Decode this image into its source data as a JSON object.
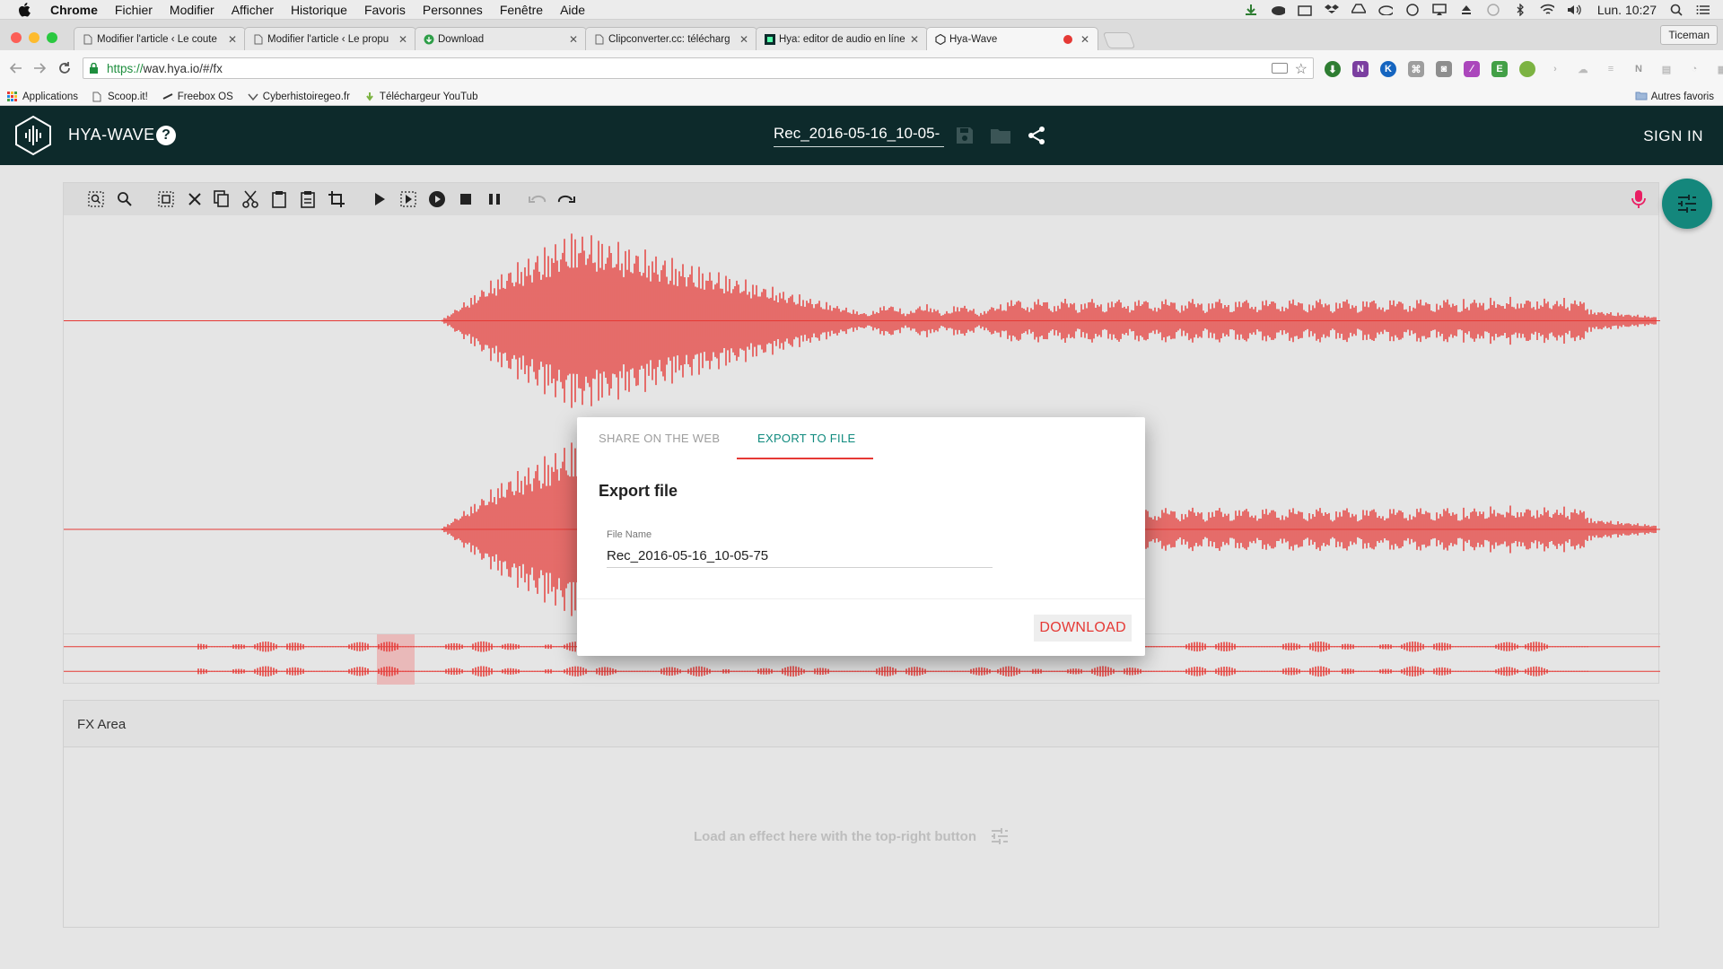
{
  "os_menubar": {
    "app": "Chrome",
    "items": [
      "Fichier",
      "Modifier",
      "Afficher",
      "Historique",
      "Favoris",
      "Personnes",
      "Fenêtre",
      "Aide"
    ],
    "clock": "Lun. 10:27"
  },
  "browser": {
    "tabs": [
      {
        "label": "Modifier l'article ‹ Le coute",
        "active": false
      },
      {
        "label": "Modifier l'article ‹ Le propu",
        "active": false
      },
      {
        "label": "Download",
        "active": false
      },
      {
        "label": "Clipconverter.cc: télécharg",
        "active": false
      },
      {
        "label": "Hya: editor de audio en líne",
        "active": false
      },
      {
        "label": "Hya-Wave",
        "active": true
      }
    ],
    "profile": "Ticeman",
    "url_https": "https://",
    "url_rest": "wav.hya.io/#/fx",
    "bookmarks": [
      "Applications",
      "Scoop.it!",
      "Freebox OS",
      "Cyberhistoiregeo.fr",
      "Téléchargeur YouTub"
    ],
    "other_bookmarks": "Autres favoris"
  },
  "app": {
    "title": "HYA-WAVE",
    "help_icon": "help-icon",
    "filename": "Rec_2016-05-16_10-05-",
    "sign_in": "SIGN IN"
  },
  "colors": {
    "header_bg": "#0d2a2b",
    "accent": "#14877c",
    "wave": "#e53935"
  },
  "fx": {
    "title": "FX Area",
    "hint": "Load an effect here with the top-right button"
  },
  "dialog": {
    "tab_share": "SHARE ON THE WEB",
    "tab_export": "EXPORT TO FILE",
    "active_tab": "EXPORT TO FILE",
    "title": "Export file",
    "field_label": "File Name",
    "field_value": "Rec_2016-05-16_10-05-75",
    "download": "DOWNLOAD"
  }
}
